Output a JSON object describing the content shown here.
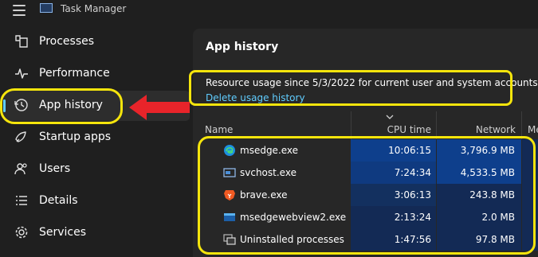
{
  "app": {
    "title": "Task Manager"
  },
  "nav": {
    "items": [
      {
        "label": "Processes",
        "icon": "processes-icon"
      },
      {
        "label": "Performance",
        "icon": "performance-icon"
      },
      {
        "label": "App history",
        "icon": "history-icon",
        "active": true
      },
      {
        "label": "Startup apps",
        "icon": "startup-icon"
      },
      {
        "label": "Users",
        "icon": "users-icon"
      },
      {
        "label": "Details",
        "icon": "details-icon"
      },
      {
        "label": "Services",
        "icon": "services-icon"
      }
    ]
  },
  "main": {
    "title": "App history",
    "info_text": "Resource usage since 5/3/2022 for current user and system accounts.",
    "delete_link": "Delete usage history",
    "columns": {
      "name": "Name",
      "cpu": "CPU time",
      "network": "Network",
      "metered": "Me"
    },
    "rows": [
      {
        "name": "msedge.exe",
        "cpu_time": "10:06:15",
        "network": "3,796.9 MB",
        "icon": "edge-icon"
      },
      {
        "name": "svchost.exe",
        "cpu_time": "7:24:34",
        "network": "4,533.5 MB",
        "icon": "service-host-icon"
      },
      {
        "name": "brave.exe",
        "cpu_time": "3:06:13",
        "network": "243.8 MB",
        "icon": "brave-icon"
      },
      {
        "name": "msedgewebview2.exe",
        "cpu_time": "2:13:24",
        "network": "2.0 MB",
        "icon": "webview-icon"
      },
      {
        "name": "Uninstalled processes",
        "cpu_time": "1:47:56",
        "network": "97.8 MB",
        "icon": "uninstalled-icon"
      }
    ]
  },
  "colors": {
    "background": "#1f1f1f",
    "panel": "#272727",
    "accent": "#60cdff",
    "highlight": "#f5e50c",
    "arrow": "#e8242a",
    "heat_high": "#0e3f8c",
    "heat_low": "#132a55"
  }
}
